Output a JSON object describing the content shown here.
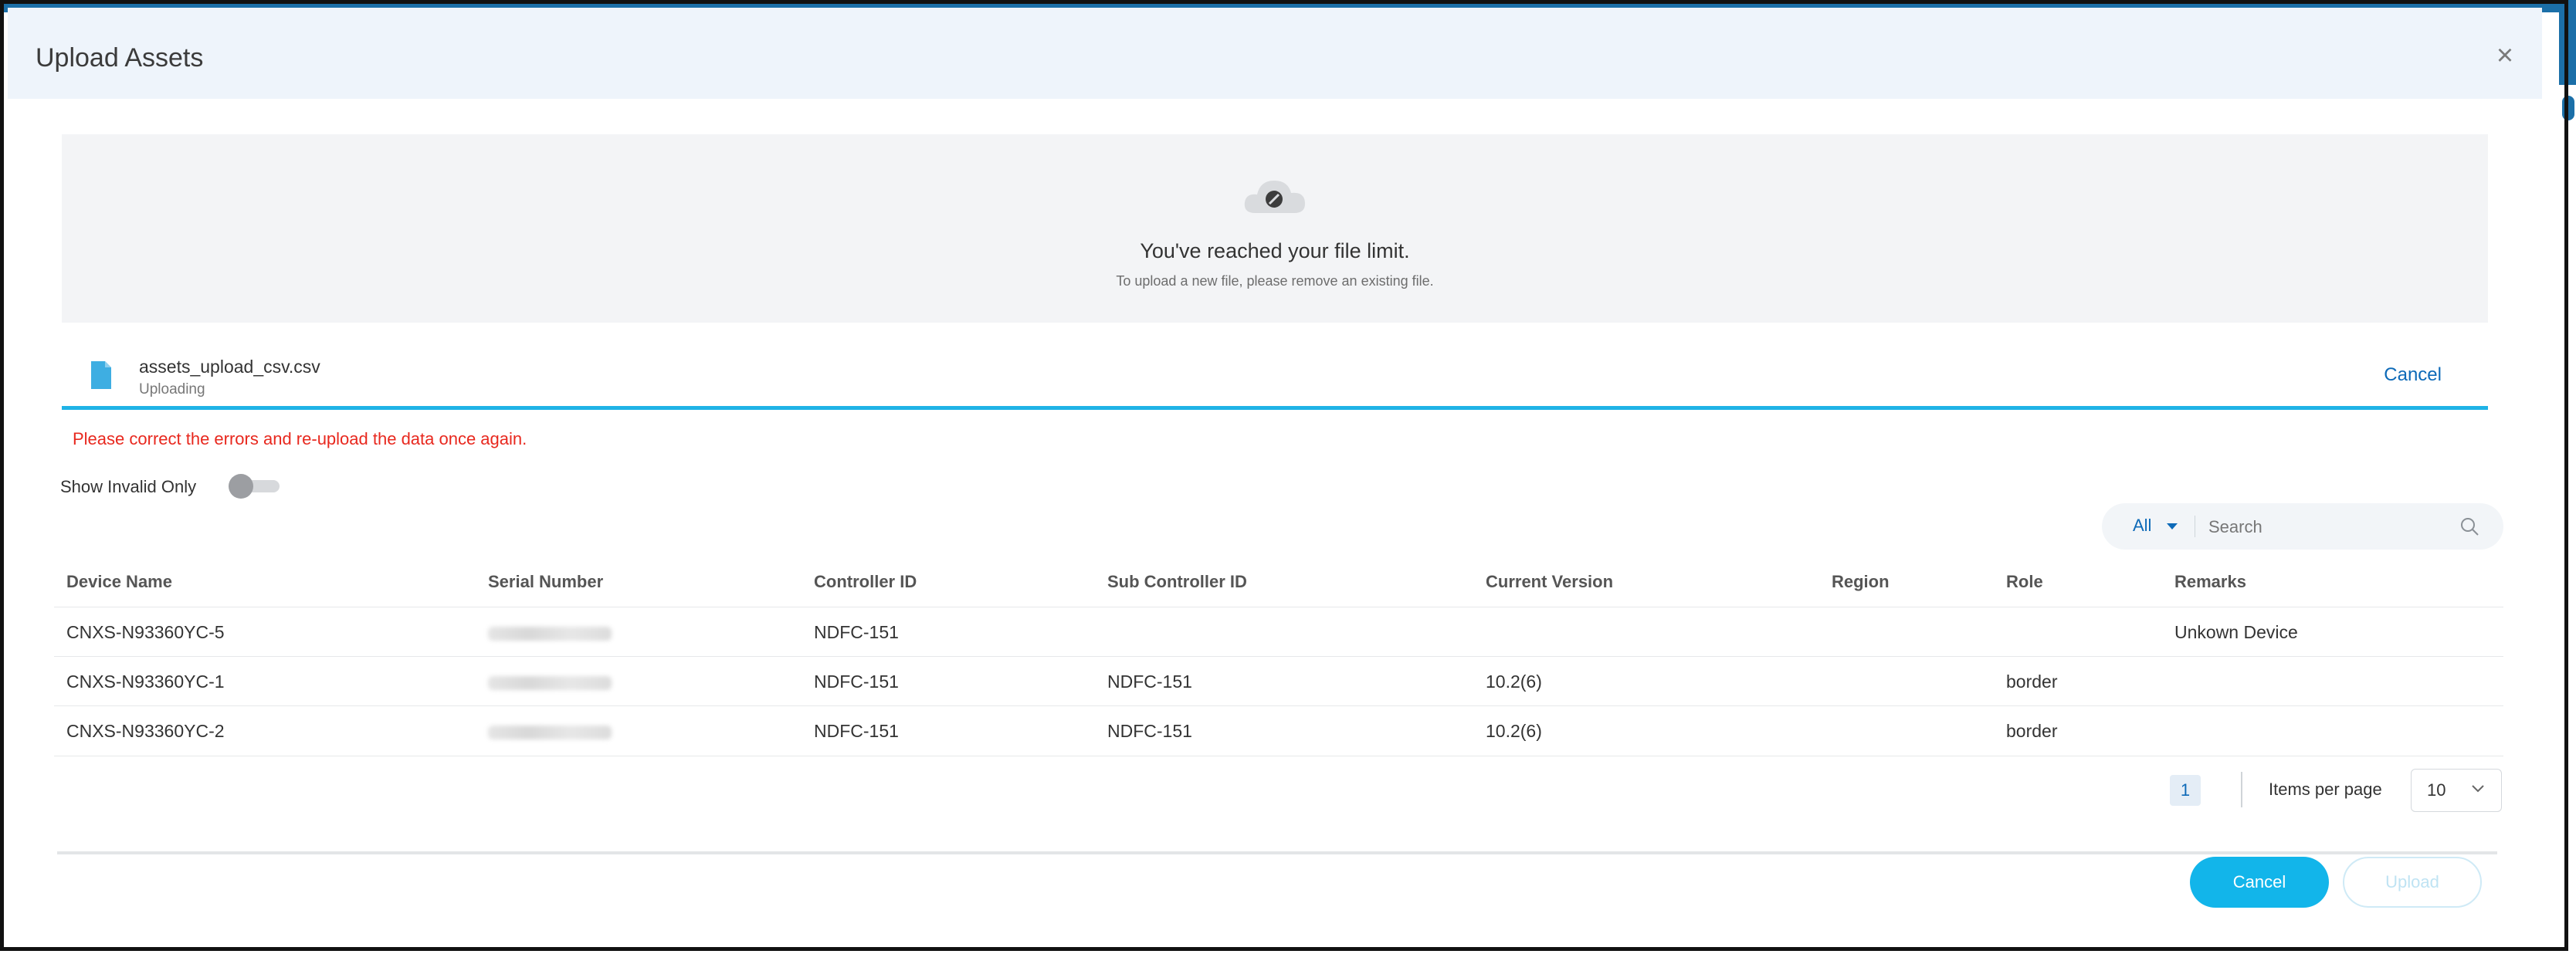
{
  "modal": {
    "title": "Upload Assets",
    "close_icon": "×"
  },
  "dropzone": {
    "icon": "cloud-blocked-icon",
    "title": "You've reached your file limit.",
    "subtitle": "To upload a new file, please remove an existing file."
  },
  "file": {
    "icon": "file-icon",
    "name": "assets_upload_csv.csv",
    "status": "Uploading",
    "cancel_label": "Cancel",
    "progress_percent": 100
  },
  "error_message": "Please correct the errors and re-upload the data once again.",
  "toggle": {
    "label": "Show Invalid Only",
    "on": false
  },
  "search": {
    "filter_value": "All",
    "placeholder": "Search",
    "icon": "search-icon"
  },
  "table": {
    "columns": [
      "Device Name",
      "Serial Number",
      "Controller ID",
      "Sub Controller ID",
      "Current Version",
      "Region",
      "Role",
      "Remarks"
    ],
    "rows": [
      [
        "CNXS-N93360YC-5",
        "",
        "NDFC-151",
        "",
        "",
        "",
        "",
        "Unkown Device"
      ],
      [
        "CNXS-N93360YC-1",
        "",
        "NDFC-151",
        "NDFC-151",
        "10.2(6)",
        "",
        "border",
        ""
      ],
      [
        "CNXS-N93360YC-2",
        "",
        "NDFC-151",
        "NDFC-151",
        "10.2(6)",
        "",
        "border",
        ""
      ]
    ]
  },
  "pagination": {
    "current_page": "1",
    "items_per_page_label": "Items per page",
    "items_per_page_value": "10"
  },
  "footer": {
    "cancel_label": "Cancel",
    "upload_label": "Upload"
  },
  "colors": {
    "accent": "#12b5ea",
    "link": "#0d6ab8",
    "error": "#e8281e",
    "header_bg": "#eef4fb"
  }
}
